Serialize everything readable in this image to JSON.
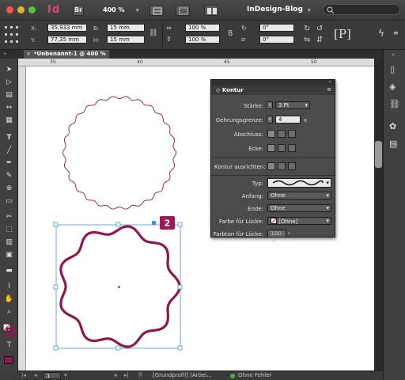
{
  "menubar": {
    "app_name": "Id",
    "bridge_label": "Br",
    "zoom": "400 %",
    "workspace": "InDesign-Blog",
    "search_placeholder": ""
  },
  "control": {
    "x_label": "X:",
    "x_value": "35,933 mm",
    "y_label": "Y:",
    "y_value": "77,35 mm",
    "b_label": "B:",
    "b_value": "15 mm",
    "h_label": "H:",
    "h_value": "15 mm",
    "scale_x": "100 %",
    "scale_y": "100 %",
    "angle1": "0°",
    "angle2": "0°"
  },
  "document": {
    "tab_label": "*Unbenannt-1 @ 400 %",
    "badge": "2",
    "ruler_marks": [
      "35",
      "40",
      "45",
      "50"
    ]
  },
  "panel": {
    "title": "Kontur",
    "staerke_label": "Stärke:",
    "staerke_value": "3 Pt",
    "gehrung_label": "Gehrungsgrenze:",
    "gehrung_value": "4",
    "gehrung_unit": "x",
    "abschluss_label": "Abschluss:",
    "ecke_label": "Ecke:",
    "ausrichten_label": "Kontur ausrichten:",
    "typ_label": "Typ:",
    "anfang_label": "Anfang:",
    "anfang_value": "Ohne",
    "ende_label": "Ende:",
    "ende_value": "Ohne",
    "farbe_label": "Farbe für Lücke:",
    "farbe_value": "[Ohne]",
    "farbton_label": "Farbton für Lücke:",
    "farbton_value": "100 %"
  },
  "status": {
    "page": "1",
    "profile": "[Grundprofil] (Arbei...",
    "preflight": "Ohne Fehler"
  },
  "colors": {
    "stroke": "#8b1a4b",
    "accent": "#e8447a",
    "selection": "#4a8fd4",
    "status_ok": "#4caf3f"
  }
}
